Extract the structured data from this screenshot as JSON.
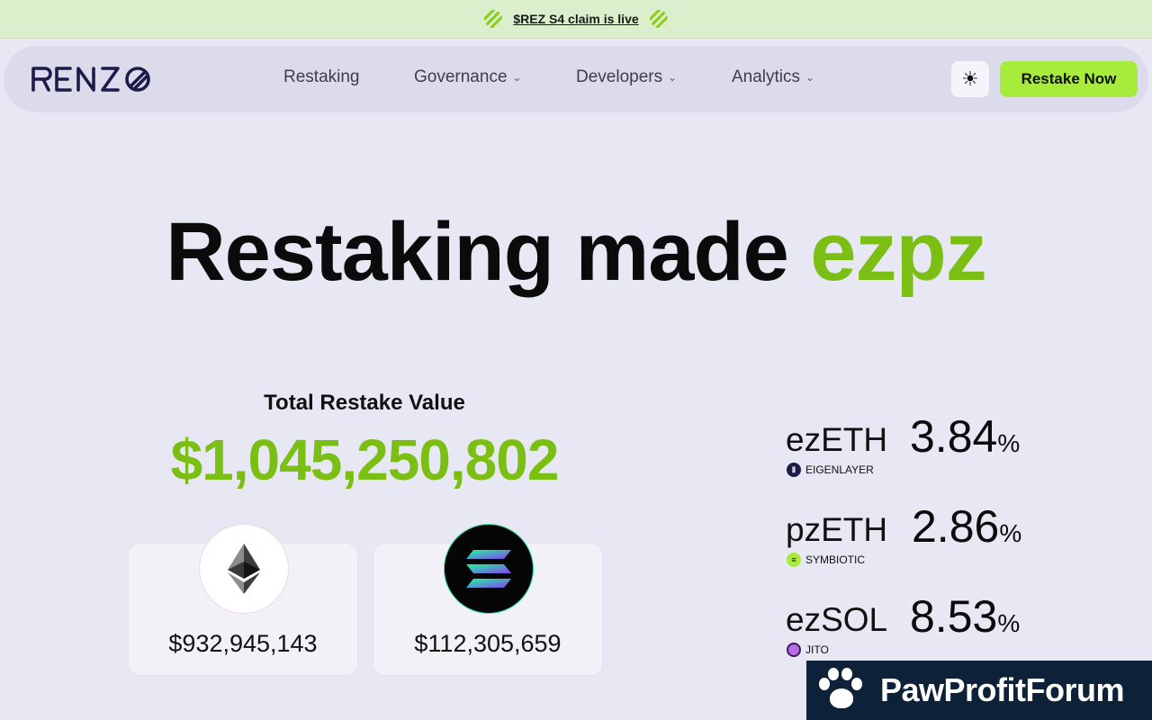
{
  "banner": {
    "text": "$REZ S4 claim is live"
  },
  "brand": {
    "name": "RENZO",
    "accent": "#a7ec3a"
  },
  "nav": {
    "items": [
      {
        "label": "Restaking",
        "dropdown": false
      },
      {
        "label": "Governance",
        "dropdown": true
      },
      {
        "label": "Developers",
        "dropdown": true
      },
      {
        "label": "Analytics",
        "dropdown": true
      }
    ],
    "theme_icon": "sun-icon",
    "cta_label": "Restake Now"
  },
  "hero": {
    "title_main": "Restaking made",
    "title_accent": "ezpz"
  },
  "tvl": {
    "label": "Total Restake Value",
    "value": "$1,045,250,802",
    "assets": [
      {
        "icon": "ethereum-icon",
        "amount": "$932,945,143"
      },
      {
        "icon": "solana-icon",
        "amount": "$112,305,659"
      }
    ]
  },
  "apr": [
    {
      "token": "ezETH",
      "value": "3.84",
      "unit": "%",
      "provider": "EIGENLAYER",
      "provider_icon": "eigenlayer-icon"
    },
    {
      "token": "pzETH",
      "value": "2.86",
      "unit": "%",
      "provider": "SYMBIOTIC",
      "provider_icon": "symbiotic-icon"
    },
    {
      "token": "ezSOL",
      "value": "8.53",
      "unit": "%",
      "provider": "JITO",
      "provider_icon": "jito-icon"
    }
  ],
  "watermark": {
    "text": "PawProfitForum"
  }
}
